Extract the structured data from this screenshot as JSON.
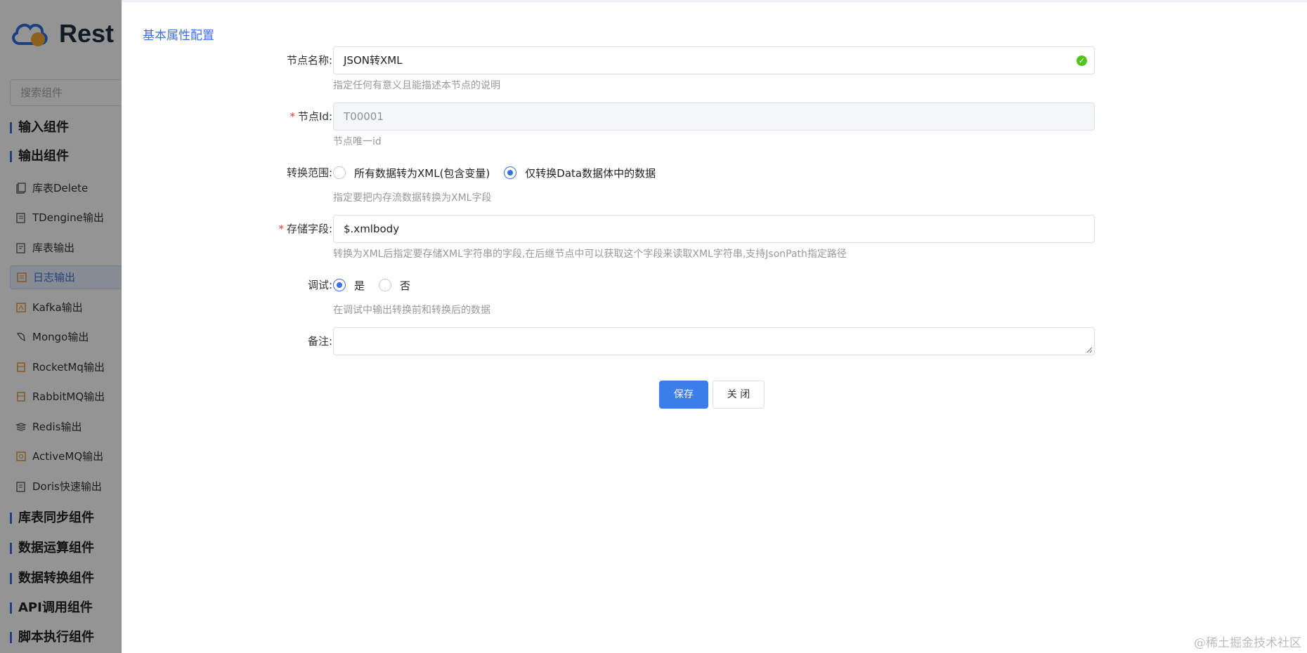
{
  "sidebar": {
    "brand": "Rest",
    "search_placeholder": "搜索组件",
    "groups": [
      {
        "label": "输入组件"
      },
      {
        "label": "输出组件"
      },
      {
        "label": "库表同步组件"
      },
      {
        "label": "数据运算组件"
      },
      {
        "label": "数据转换组件"
      },
      {
        "label": "API调用组件"
      },
      {
        "label": "脚本执行组件"
      }
    ],
    "items": [
      {
        "label": "库表Delete",
        "icon": "table-delete-icon"
      },
      {
        "label": "TDengine输出",
        "icon": "table-icon"
      },
      {
        "label": "库表输出",
        "icon": "table-output-icon"
      },
      {
        "label": "日志输出",
        "icon": "log-icon",
        "active": true
      },
      {
        "label": "Kafka输出",
        "icon": "kafka-icon"
      },
      {
        "label": "Mongo输出",
        "icon": "mongo-icon"
      },
      {
        "label": "RocketMq输出",
        "icon": "queue-icon"
      },
      {
        "label": "RabbitMQ输出",
        "icon": "queue-icon"
      },
      {
        "label": "Redis输出",
        "icon": "redis-icon"
      },
      {
        "label": "ActiveMQ输出",
        "icon": "mq-icon"
      },
      {
        "label": "Doris快速输出",
        "icon": "doris-icon"
      }
    ]
  },
  "form": {
    "section_title": "基本属性配置",
    "node_name": {
      "label": "节点名称:",
      "value": "JSON转XML",
      "hint": "指定任何有意义且能描述本节点的说明"
    },
    "node_id": {
      "required": "*",
      "label": "节点Id:",
      "value": "T00001",
      "hint": "节点唯一id"
    },
    "convert_scope": {
      "label": "转换范围:",
      "options": [
        "所有数据转为XML(包含变量)",
        "仅转换Data数据体中的数据"
      ],
      "selected": "仅转换Data数据体中的数据",
      "hint": "指定要把内存流数据转换为XML字段"
    },
    "store_field": {
      "required": "*",
      "label": "存储字段:",
      "value": "$.xmlbody",
      "hint": "转换为XML后指定要存储XML字符串的字段,在后继节点中可以获取这个字段来读取XML字符串,支持JsonPath指定路径"
    },
    "debug": {
      "label": "调试:",
      "options": [
        "是",
        "否"
      ],
      "selected": "是",
      "hint": "在调试中输出转换前和转换后的数据"
    },
    "remark": {
      "label": "备注:",
      "value": ""
    },
    "save_label": "保存",
    "close_label": "关 闭"
  },
  "watermark": "@稀土掘金技术社区",
  "colors": {
    "accent": "#3b7de9",
    "success": "#52c41a",
    "required": "#e63d3d"
  }
}
